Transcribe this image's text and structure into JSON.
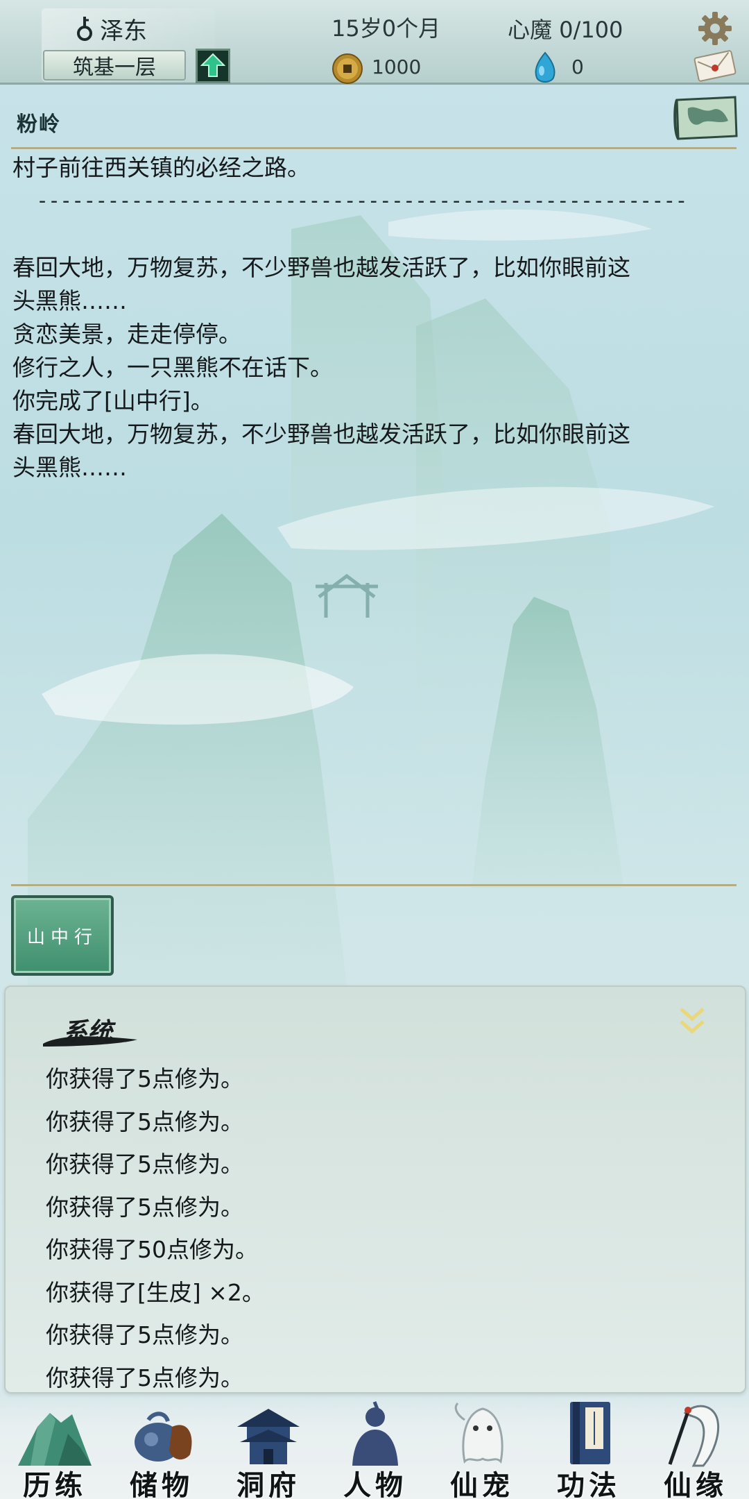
{
  "player": {
    "name": "泽东",
    "realm": "筑基一层",
    "age": "15岁0个月",
    "coins": "1000",
    "inner_demon": "心魔  0/100",
    "spirit_stones": "0"
  },
  "location": {
    "name": "粉岭"
  },
  "story": {
    "lines": [
      "村子前往西关镇的必经之路。",
      "-------------------------------------------------------",
      "",
      "春回大地，万物复苏，不少野兽也越发活跃了，比如你眼前这",
      "头黑熊……",
      "贪恋美景，走走停停。",
      "修行之人，一只黑熊不在话下。",
      "你完成了[山中行]。",
      "春回大地，万物复苏，不少野兽也越发活跃了，比如你眼前这",
      "头黑熊……"
    ]
  },
  "event_button": {
    "label": "山中行"
  },
  "system": {
    "title": "系统",
    "messages": [
      "你获得了5点修为。",
      "你获得了5点修为。",
      "你获得了5点修为。",
      "你获得了5点修为。",
      "你获得了50点修为。",
      "你获得了[生皮] ×2。",
      "你获得了5点修为。",
      "你获得了5点修为。"
    ]
  },
  "nav": {
    "items": [
      {
        "label": "历练",
        "icon": "mountain-icon"
      },
      {
        "label": "储物",
        "icon": "bag-icon"
      },
      {
        "label": "洞府",
        "icon": "pavilion-icon"
      },
      {
        "label": "人物",
        "icon": "person-icon"
      },
      {
        "label": "仙宠",
        "icon": "ghost-pet-icon"
      },
      {
        "label": "功法",
        "icon": "book-icon"
      },
      {
        "label": "仙缘",
        "icon": "crane-icon"
      }
    ]
  },
  "colors": {
    "accent_green": "#3f8f6e",
    "rule_gold": "#b2ad86",
    "mountain": "#7fb7a6"
  }
}
